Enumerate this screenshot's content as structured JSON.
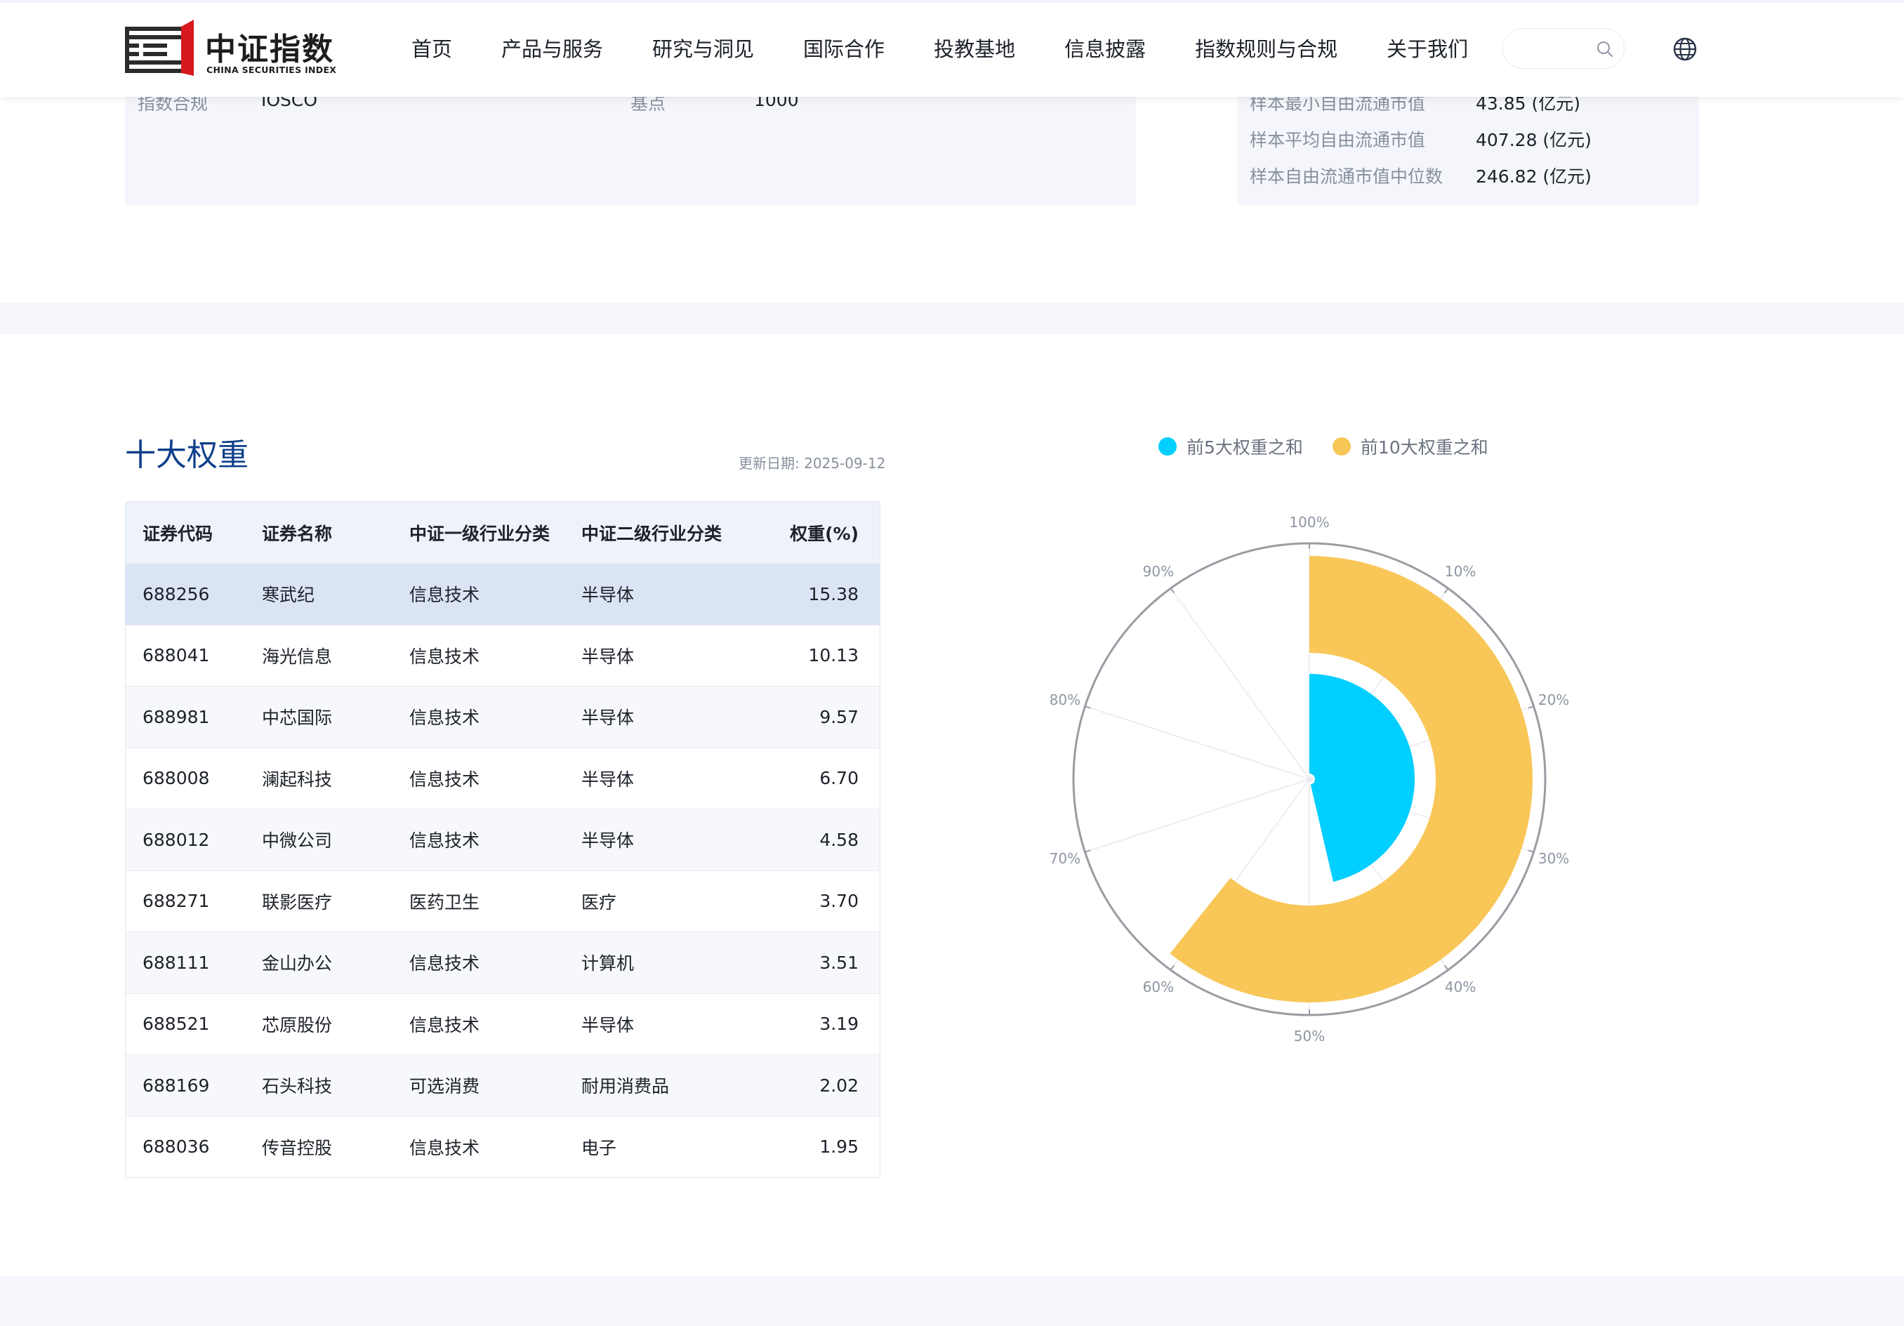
{
  "header": {
    "logo_cn": "中证指数",
    "logo_en": "CHINA SECURITIES INDEX",
    "nav": [
      "首页",
      "产品与服务",
      "研究与洞见",
      "国际合作",
      "投教基地",
      "信息披露",
      "指数规则与合规",
      "关于我们"
    ],
    "search_placeholder": ""
  },
  "info_partial": {
    "left_label": "指数合规",
    "left_value": "IOSCO",
    "mid_label": "基点",
    "mid_value": "1000",
    "right_rows": [
      {
        "label": "样本最小自由流通市值",
        "value": "43.85 (亿元)"
      },
      {
        "label": "样本平均自由流通市值",
        "value": "407.28 (亿元)"
      },
      {
        "label": "样本自由流通市值中位数",
        "value": "246.82 (亿元)"
      }
    ]
  },
  "top_ten": {
    "title": "十大权重",
    "update_label": "更新日期:",
    "update_date": "2025-09-12",
    "columns": [
      "证券代码",
      "证券名称",
      "中证一级行业分类",
      "中证二级行业分类",
      "权重(%)"
    ],
    "rows": [
      {
        "code": "688256",
        "name": "寒武纪",
        "level1": "信息技术",
        "level2": "半导体",
        "weight": "15.38"
      },
      {
        "code": "688041",
        "name": "海光信息",
        "level1": "信息技术",
        "level2": "半导体",
        "weight": "10.13"
      },
      {
        "code": "688981",
        "name": "中芯国际",
        "level1": "信息技术",
        "level2": "半导体",
        "weight": "9.57"
      },
      {
        "code": "688008",
        "name": "澜起科技",
        "level1": "信息技术",
        "level2": "半导体",
        "weight": "6.70"
      },
      {
        "code": "688012",
        "name": "中微公司",
        "level1": "信息技术",
        "level2": "半导体",
        "weight": "4.58"
      },
      {
        "code": "688271",
        "name": "联影医疗",
        "level1": "医药卫生",
        "level2": "医疗",
        "weight": "3.70"
      },
      {
        "code": "688111",
        "name": "金山办公",
        "level1": "信息技术",
        "level2": "计算机",
        "weight": "3.51"
      },
      {
        "code": "688521",
        "name": "芯原股份",
        "level1": "信息技术",
        "level2": "半导体",
        "weight": "3.19"
      },
      {
        "code": "688169",
        "name": "石头科技",
        "level1": "可选消费",
        "level2": "耐用消费品",
        "weight": "2.02"
      },
      {
        "code": "688036",
        "name": "传音控股",
        "level1": "信息技术",
        "level2": "电子",
        "weight": "1.95"
      }
    ],
    "selected_row": 0
  },
  "chart_data": {
    "type": "polar-bar",
    "series": [
      {
        "name": "前5大权重之和",
        "value": 46.36,
        "color": "#00cfff"
      },
      {
        "name": "前10大权重之和",
        "value": 60.73,
        "color": "#f8c758"
      }
    ],
    "angle_ticks": [
      "100%",
      "10%",
      "20%",
      "30%",
      "40%",
      "50%",
      "60%",
      "70%",
      "80%",
      "90%"
    ],
    "angle_range": [
      0,
      100
    ],
    "legend_position": "top"
  }
}
